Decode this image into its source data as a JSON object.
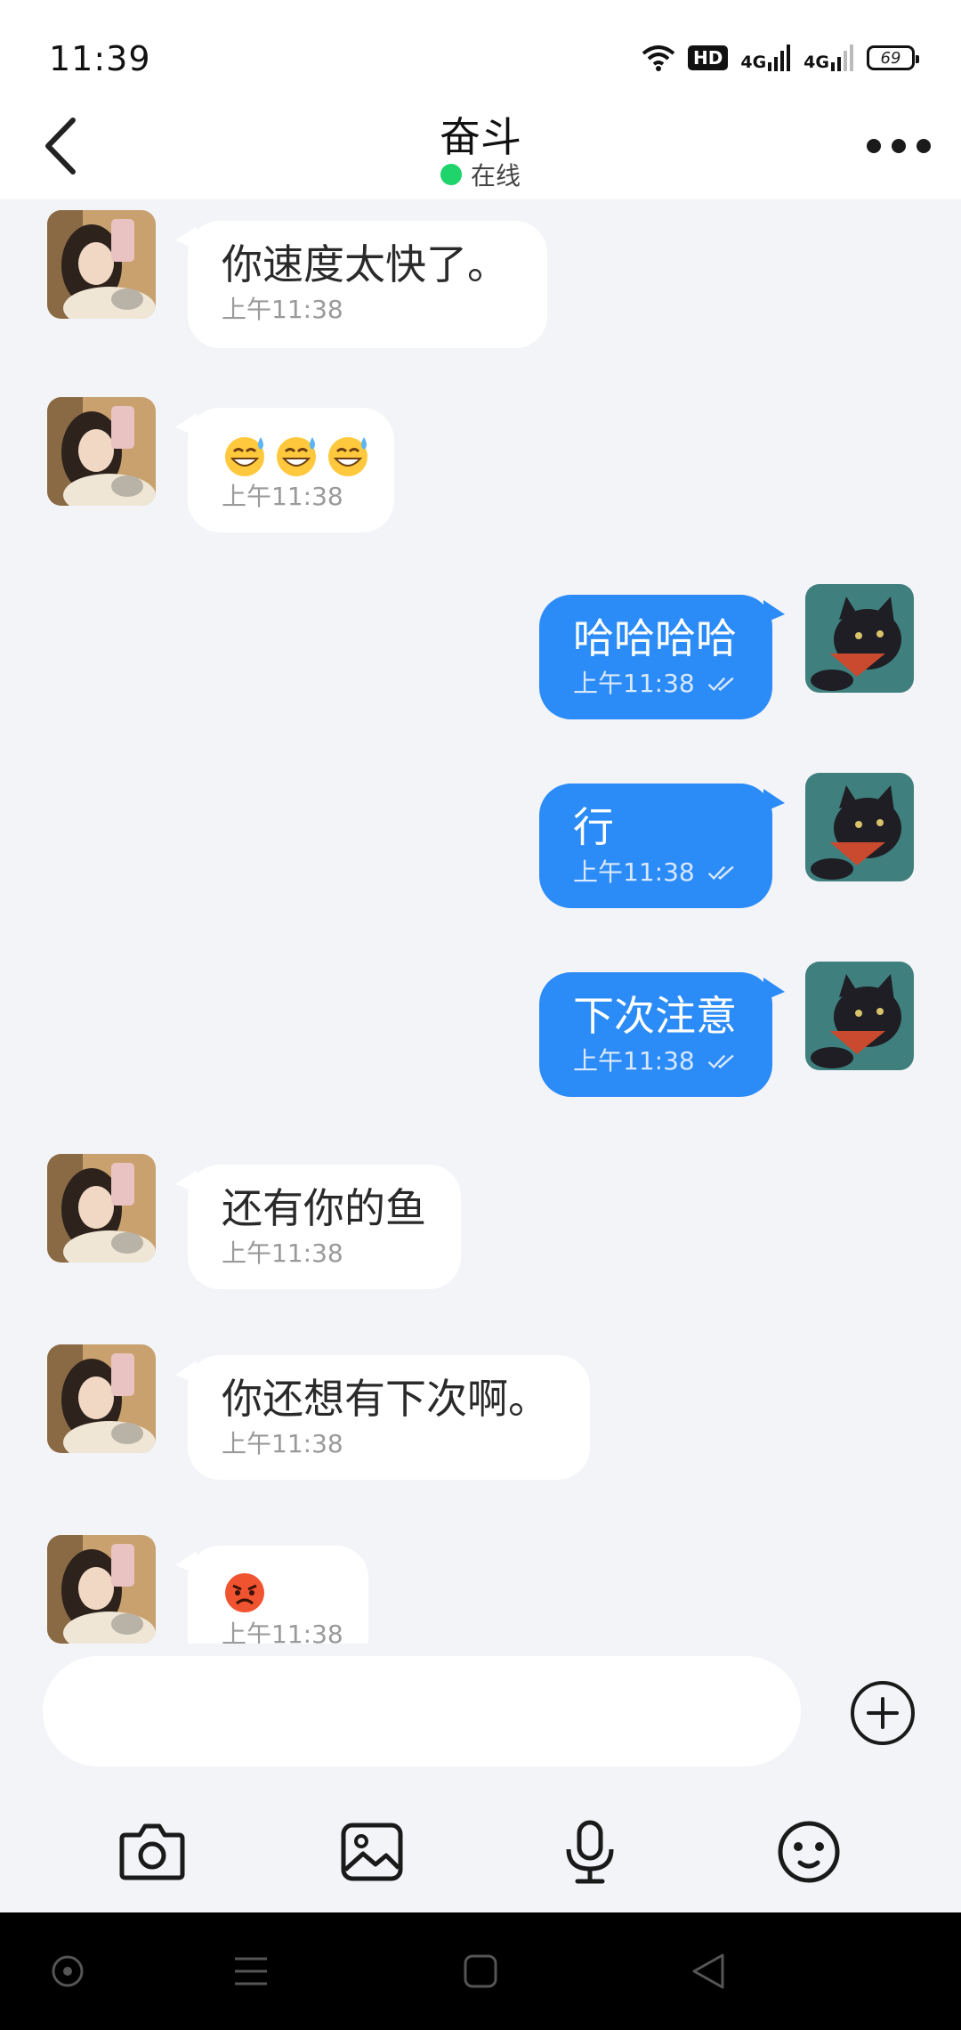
{
  "status_bar": {
    "time": "11:39",
    "hd_label": "HD",
    "network_1": "4G",
    "network_2": "4G",
    "battery": "69"
  },
  "header": {
    "title": "奋斗",
    "status": "在线",
    "status_color": "#1fd46b"
  },
  "colors": {
    "outgoing_bubble": "#2b8bf7",
    "incoming_bubble": "#ffffff",
    "background": "#f3f4f8"
  },
  "messages": [
    {
      "direction": "in",
      "text": "你速度太快了。",
      "time": "上午11:38"
    },
    {
      "direction": "in",
      "text": "",
      "emojis": [
        "grinning-sweat",
        "grinning-sweat",
        "grinning-sweat"
      ],
      "time": "上午11:38"
    },
    {
      "direction": "out",
      "text": "哈哈哈哈",
      "time": "上午11:38",
      "read": true
    },
    {
      "direction": "out",
      "text": "行",
      "time": "上午11:38",
      "read": true
    },
    {
      "direction": "out",
      "text": "下次注意",
      "time": "上午11:38",
      "read": true
    },
    {
      "direction": "in",
      "text": "还有你的鱼",
      "time": "上午11:38"
    },
    {
      "direction": "in",
      "text": "你还想有下次啊。",
      "time": "上午11:38"
    },
    {
      "direction": "in",
      "text": "",
      "emojis": [
        "angry-face"
      ],
      "time": "上午11:38"
    }
  ],
  "composer": {
    "placeholder": ""
  },
  "icons": {
    "back": "chevron-left-icon",
    "more": "more-dots-icon",
    "plus": "plus-circle-icon",
    "camera": "camera-icon",
    "gallery": "image-icon",
    "voice": "microphone-icon",
    "emoji": "emoji-icon"
  }
}
